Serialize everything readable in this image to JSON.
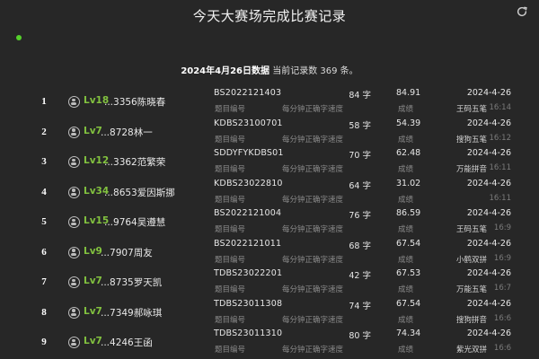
{
  "header": {
    "title": "今天大赛场完成比赛记录",
    "refresh_icon": "refresh-icon",
    "status_color": "#55d12b"
  },
  "summary": {
    "date_text": "2024年4月26日数据",
    "count_text": "当前记录数 369 条。"
  },
  "labels": {
    "code": "题目编号",
    "speed": "每分钟正确字速度",
    "score": "成绩"
  },
  "records": [
    {
      "rank": "1",
      "level": "Lv18",
      "user": "...3356陈晓春",
      "code": "BS2022121403",
      "speed": "84 字",
      "score": "84.91",
      "date": "2024-4-26",
      "tool": "王码五笔",
      "time": "16:14"
    },
    {
      "rank": "2",
      "level": "Lv7",
      "user": "...8728林一",
      "code": "KDBS23100701",
      "speed": "58 字",
      "score": "54.39",
      "date": "2024-4-26",
      "tool": "搜狗五笔",
      "time": "16:12"
    },
    {
      "rank": "3",
      "level": "Lv12",
      "user": "...3362范繁荣",
      "code": "SDDYFYKDBS01",
      "speed": "70 字",
      "score": "62.48",
      "date": "2024-4-26",
      "tool": "万能拼音",
      "time": "16:11"
    },
    {
      "rank": "4",
      "level": "Lv34",
      "user": "...8653爱因斯挪",
      "code": "KDBS23022810",
      "speed": "64 字",
      "score": "31.02",
      "date": "2024-4-26",
      "tool": "",
      "time": "16:11"
    },
    {
      "rank": "5",
      "level": "Lv15",
      "user": "...9764吴遵慧",
      "code": "BS2022121004",
      "speed": "76 字",
      "score": "86.59",
      "date": "2024-4-26",
      "tool": "王码五笔",
      "time": "16:9"
    },
    {
      "rank": "6",
      "level": "Lv9",
      "user": "...7907周友",
      "code": "BS2022121011",
      "speed": "68 字",
      "score": "67.54",
      "date": "2024-4-26",
      "tool": "小鹤双拼",
      "time": "16:9"
    },
    {
      "rank": "7",
      "level": "Lv7",
      "user": "...8735罗天凯",
      "code": "TDBS23022201",
      "speed": "42 字",
      "score": "67.53",
      "date": "2024-4-26",
      "tool": "万能五笔",
      "time": "16:7"
    },
    {
      "rank": "8",
      "level": "Lv7",
      "user": "...7349郝咏琪",
      "code": "TDBS23011308",
      "speed": "74 字",
      "score": "67.54",
      "date": "2024-4-26",
      "tool": "搜狗拼音",
      "time": "16:6"
    },
    {
      "rank": "9",
      "level": "Lv7",
      "user": "...4246王函",
      "code": "TDBS23011310",
      "speed": "80 字",
      "score": "74.34",
      "date": "2024-4-26",
      "tool": "紫光双拼",
      "time": "16:6"
    }
  ]
}
